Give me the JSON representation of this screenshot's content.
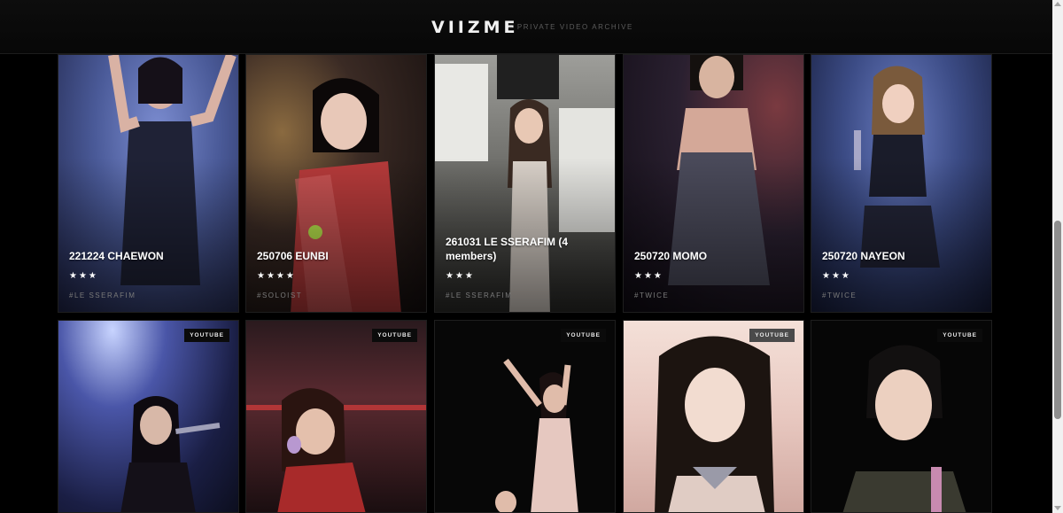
{
  "header": {
    "logo": "VIIZME",
    "tagline": "– PRIVATE VIDEO ARCHIVE"
  },
  "top_row": [
    {
      "title": "221224 CHAEWON",
      "stars": "★★★",
      "tag": "#LE SSERAFIM"
    },
    {
      "title": "250706 EUNBI",
      "stars": "★★★★",
      "tag": "#SOLOIST"
    },
    {
      "title": "261031 LE SSERAFIM (4 members)",
      "stars": "★★★",
      "tag": "#LE SSERAFIM"
    },
    {
      "title": "250720 MOMO",
      "stars": "★★★",
      "tag": "#TWICE"
    },
    {
      "title": "250720 NAYEON",
      "stars": "★★★",
      "tag": "#TWICE"
    }
  ],
  "bottom_row": [
    {
      "badge": "YOUTUBE"
    },
    {
      "badge": "YOUTUBE"
    },
    {
      "badge": "YOUTUBE"
    },
    {
      "badge": "YOUTUBE"
    },
    {
      "badge": "YOUTUBE"
    }
  ],
  "colors": {
    "background": "#000000",
    "card1": "#4a5a98",
    "card2": "#3a2a24",
    "card3": "#8a8a86",
    "card4": "#2a2030",
    "card5": "#3c4c86"
  }
}
